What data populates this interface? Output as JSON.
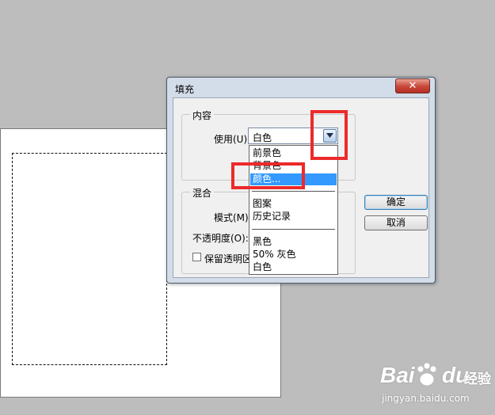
{
  "dialog": {
    "title": "填充",
    "close_label": "✕",
    "content_group": {
      "label": "内容",
      "use_label": "使用(U):",
      "use_value": "白色"
    },
    "blend_group": {
      "label": "混合",
      "mode_label": "模式(M):",
      "opacity_label": "不透明度(O):",
      "preserve_label": "保留透明区"
    },
    "ok_label": "确定",
    "cancel_label": "取消"
  },
  "dropdown": {
    "options": [
      "前景色",
      "背景色",
      "颜色...",
      "图案",
      "历史记录",
      "黑色",
      "50% 灰色",
      "白色"
    ],
    "highlighted": "颜色..."
  },
  "watermark": {
    "brand_left": "Bai",
    "brand_right": "du",
    "brand_cn": "经验",
    "url": "jingyan.baidu.com"
  },
  "colors": {
    "highlight": "#3399ff",
    "annotation": "#ec2a2a"
  }
}
